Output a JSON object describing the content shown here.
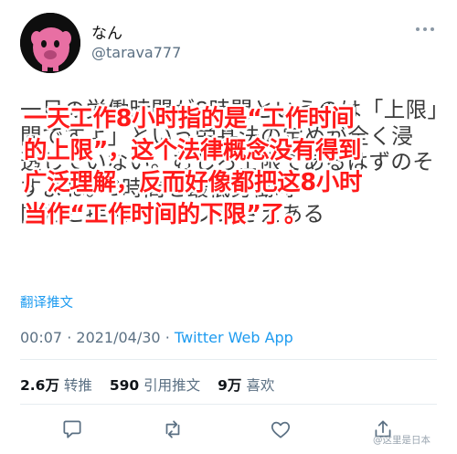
{
  "tweet": {
    "display_name": "なん",
    "username": "@tarava777",
    "jp_lines": [
      "一日の労働時間が8時間というのは「上限」",
      "間ですよ」という労基法の定めが全く浸",
      "透していない。むしろ上限であるはずのそ",
      "すよね。8時間を最低労働時",
      "間だと捉えているフシさえある"
    ],
    "cn_lines": [
      "一天工作8小时指的是“工作时间",
      "的上限”，这个法律概念没有得到",
      "广泛理解，反而好像都把这8小时",
      "当作“工作时间的下限”了。"
    ],
    "translate_label": "翻译推文",
    "time": "00:07",
    "separator": "·",
    "date": "2021/04/30",
    "source": "Twitter Web App",
    "stats": {
      "retweets_count": "2.6万",
      "retweets_label": "转推",
      "quotes_count": "590",
      "quotes_label": "引用推文",
      "likes_count": "9万",
      "likes_label": "喜欢"
    }
  },
  "icons": [
    "avatar",
    "more-icon",
    "reply-icon",
    "retweet-icon",
    "like-icon",
    "share-icon"
  ],
  "colors": {
    "link": "#1d9bf0",
    "secondary": "#5b7083",
    "overlay_text": "#ff1a1a"
  },
  "watermark": "@这里是日本"
}
